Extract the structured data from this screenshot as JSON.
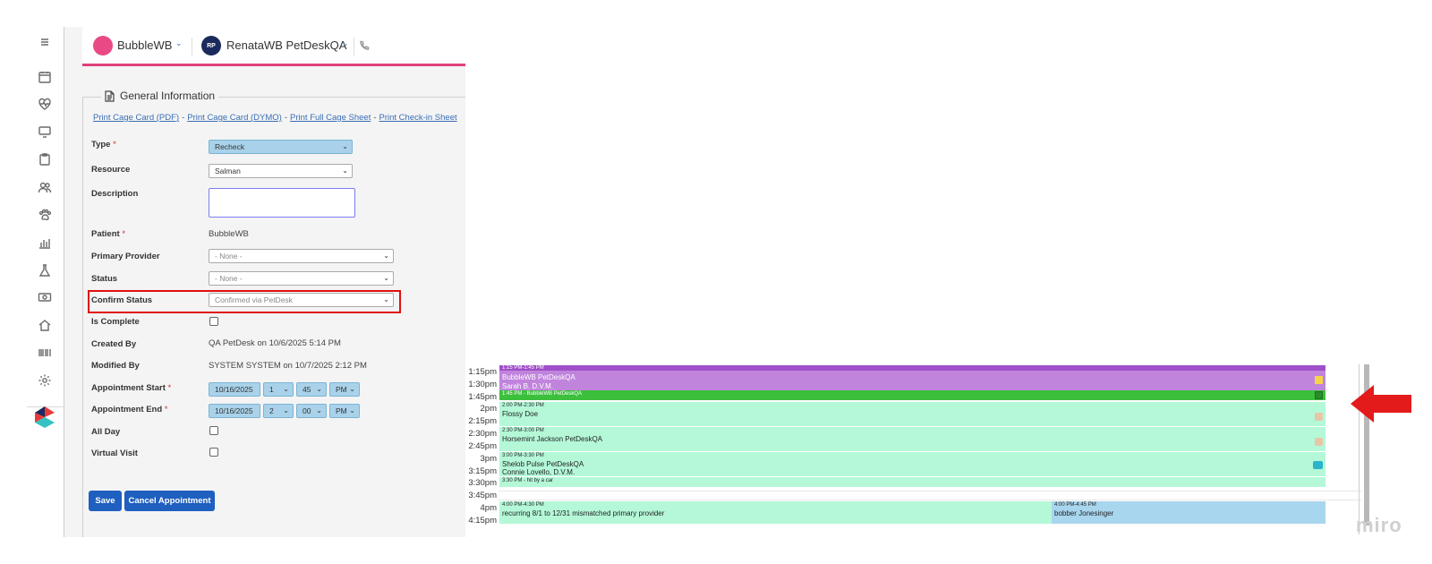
{
  "header": {
    "pet_name": "BubbleWB",
    "client_initials": "RP",
    "client_name": "RenataWB PetDeskQA",
    "chevron": "⌄"
  },
  "section": {
    "title": "General Information"
  },
  "print_links": [
    "Print Cage Card (PDF)",
    "Print Cage Card (DYMO)",
    "Print Full Cage Sheet",
    "Print Check-in Sheet"
  ],
  "print_sep": "-",
  "form": {
    "type": {
      "label": "Type",
      "req": "*",
      "value": "Recheck"
    },
    "resource": {
      "label": "Resource",
      "value": "Salman"
    },
    "description": {
      "label": "Description"
    },
    "patient": {
      "label": "Patient",
      "req": "*",
      "value": "BubbleWB"
    },
    "primary_provider": {
      "label": "Primary Provider",
      "value": "- None -"
    },
    "status": {
      "label": "Status",
      "value": "- None -"
    },
    "confirm_status": {
      "label": "Confirm Status",
      "value": "Confirmed via PetDesk"
    },
    "is_complete": {
      "label": "Is Complete"
    },
    "created_by": {
      "label": "Created By",
      "value": "QA PetDesk on 10/6/2025 5:14 PM"
    },
    "modified_by": {
      "label": "Modified By",
      "value": "SYSTEM SYSTEM on 10/7/2025 2:12 PM"
    },
    "appt_start": {
      "label": "Appointment Start",
      "req": "*",
      "date": "10/16/2025",
      "hour": "1",
      "minute": "45",
      "ampm": "PM"
    },
    "appt_end": {
      "label": "Appointment End",
      "req": "*",
      "date": "10/16/2025",
      "hour": "2",
      "minute": "00",
      "ampm": "PM"
    },
    "all_day": {
      "label": "All Day"
    },
    "virtual_visit": {
      "label": "Virtual Visit"
    }
  },
  "buttons": {
    "save": "Save",
    "cancel": "Cancel Appointment"
  },
  "calendar": {
    "times": [
      "1:15pm",
      "1:30pm",
      "1:45pm",
      "2pm",
      "2:15pm",
      "2:30pm",
      "2:45pm",
      "3pm",
      "3:15pm",
      "3:30pm",
      "3:45pm",
      "4pm",
      "4:15pm"
    ],
    "appointments": [
      {
        "time": "1:15 PM-1:45 PM",
        "name": "BubbleWB PetDeskQA",
        "provider": "Sarah B. D.V.M."
      },
      {
        "time": "1:45 PM - BubbleWB PetDeskQA"
      },
      {
        "time": "2:00 PM-2:30 PM",
        "name": "Flossy Doe"
      },
      {
        "time": "2:30 PM-3:00 PM",
        "name": "Horsemint Jackson PetDeskQA"
      },
      {
        "time": "3:00 PM-3:30 PM",
        "name": "Shelob Pulse PetDeskQA",
        "provider": "Connie Lovello, D.V.M."
      },
      {
        "time": "3:30 PM - hit by a car"
      },
      {
        "time": "4:00 PM-4:30 PM",
        "name": "recurring 8/1 to 12/31 mismatched primary provider"
      },
      {
        "time": "4:00 PM-4:45 PM",
        "name": "bobber Jonesinger"
      }
    ]
  },
  "colors": {
    "accent_pink": "#e0407a",
    "primary_blue": "#1f5fbf",
    "highlight_red": "#e01010",
    "appt_purple": "#c084dc",
    "appt_green": "#3cc03c",
    "appt_mint": "#b4f8d8",
    "appt_blue": "#a8d6ee"
  },
  "watermark": "miro"
}
